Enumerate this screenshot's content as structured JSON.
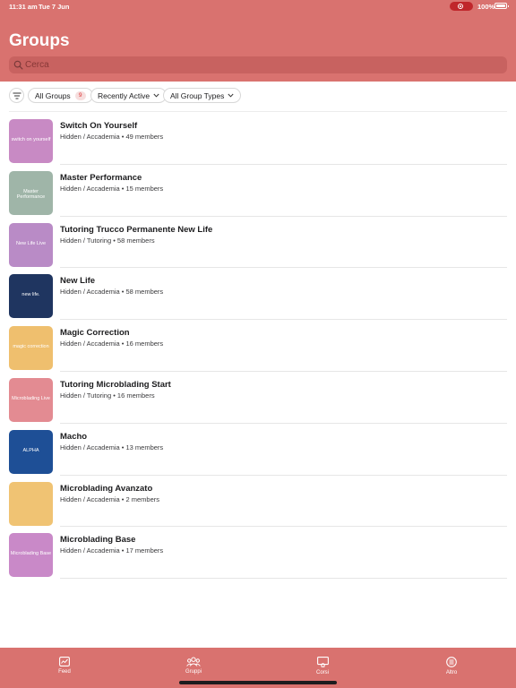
{
  "status_bar": {
    "time": "11:31 am",
    "date": "Tue 7 Jun",
    "battery": "100%"
  },
  "header": {
    "title": "Groups"
  },
  "search": {
    "placeholder": "Cerca"
  },
  "filters": {
    "all_groups_label": "All Groups",
    "all_groups_count": "9",
    "sort_label": "Recently Active",
    "type_label": "All Group Types"
  },
  "groups": [
    {
      "name": "Switch On Yourself",
      "meta": "Hidden / Accademia  •  49 members",
      "thumb_text": "switch on yourself",
      "color": "#c88ac4"
    },
    {
      "name": "Master Performance",
      "meta": "Hidden / Accademia  •  15 members",
      "thumb_text": "Master Performance",
      "color": "#9fb5a8"
    },
    {
      "name": "Tutoring Trucco Permanente New Life",
      "meta": "Hidden / Tutoring  •  58 members",
      "thumb_text": "New Life Live",
      "color": "#b98bc6"
    },
    {
      "name": "New Life",
      "meta": "Hidden / Accademia  •  58 members",
      "thumb_text": "new life.",
      "color": "#1f3560"
    },
    {
      "name": "Magic Correction",
      "meta": "Hidden / Accademia  •  16 members",
      "thumb_text": "magic correction",
      "color": "#efbf6e"
    },
    {
      "name": "Tutoring Microblading Start",
      "meta": "Hidden / Tutoring  •  16 members",
      "thumb_text": "Microblading Live",
      "color": "#e38b92"
    },
    {
      "name": "Macho",
      "meta": "Hidden / Accademia  •  13 members",
      "thumb_text": "ALPHA",
      "color": "#1e4f96"
    },
    {
      "name": "Microblading Avanzato",
      "meta": "Hidden / Accademia  •  2 members",
      "thumb_text": "",
      "color": "#f0c373"
    },
    {
      "name": "Microblading Base",
      "meta": "Hidden / Accademia  •  17 members",
      "thumb_text": "Microblading Base",
      "color": "#c989c8"
    }
  ],
  "tabbar": {
    "feed": "Feed",
    "groups": "Gruppi",
    "courses": "Corsi",
    "more": "Altro"
  },
  "colors": {
    "brand": "#d9726f"
  }
}
